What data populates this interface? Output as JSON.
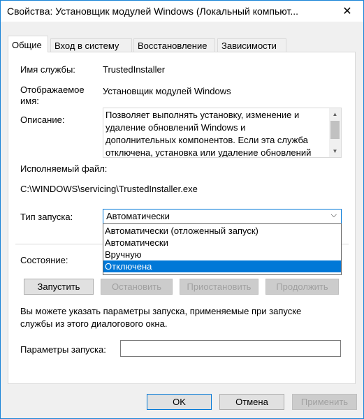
{
  "window": {
    "title": "Свойства: Установщик модулей Windows (Локальный компьют...",
    "close_glyph": "✕"
  },
  "tabs": [
    {
      "label": "Общие"
    },
    {
      "label": "Вход в систему"
    },
    {
      "label": "Восстановление"
    },
    {
      "label": "Зависимости"
    }
  ],
  "general": {
    "service_name_label": "Имя службы:",
    "service_name_value": "TrustedInstaller",
    "display_name_label_1": "Отображаемое",
    "display_name_label_2": "имя:",
    "display_name_value": "Установщик модулей Windows",
    "description_label": "Описание:",
    "description_lines": [
      "Позволяет выполнять установку, изменение и",
      "удаление обновлений Windows и",
      "дополнительных компонентов. Если эта служба",
      "отключена, установка или удаление обновлений"
    ],
    "exe_label": "Исполняемый файл:",
    "exe_path": "C:\\WINDOWS\\servicing\\TrustedInstaller.exe",
    "startup_type_label": "Тип запуска:",
    "startup_type_value": "Автоматически",
    "startup_options": [
      "Автоматически (отложенный запуск)",
      "Автоматически",
      "Вручную",
      "Отключена"
    ],
    "startup_selected_index": 3,
    "status_label": "Состояние:",
    "buttons": {
      "start": "Запустить",
      "stop": "Остановить",
      "pause": "Приостановить",
      "resume": "Продолжить"
    },
    "hint_line_1": "Вы можете указать параметры запуска, применяемые при запуске",
    "hint_line_2": "службы из этого диалогового окна.",
    "params_label": "Параметры запуска:",
    "params_value": ""
  },
  "footer": {
    "ok": "OK",
    "cancel": "Отмена",
    "apply": "Применить"
  },
  "colors": {
    "accent": "#0078d7",
    "selected_item_bg": "#0078d7"
  }
}
